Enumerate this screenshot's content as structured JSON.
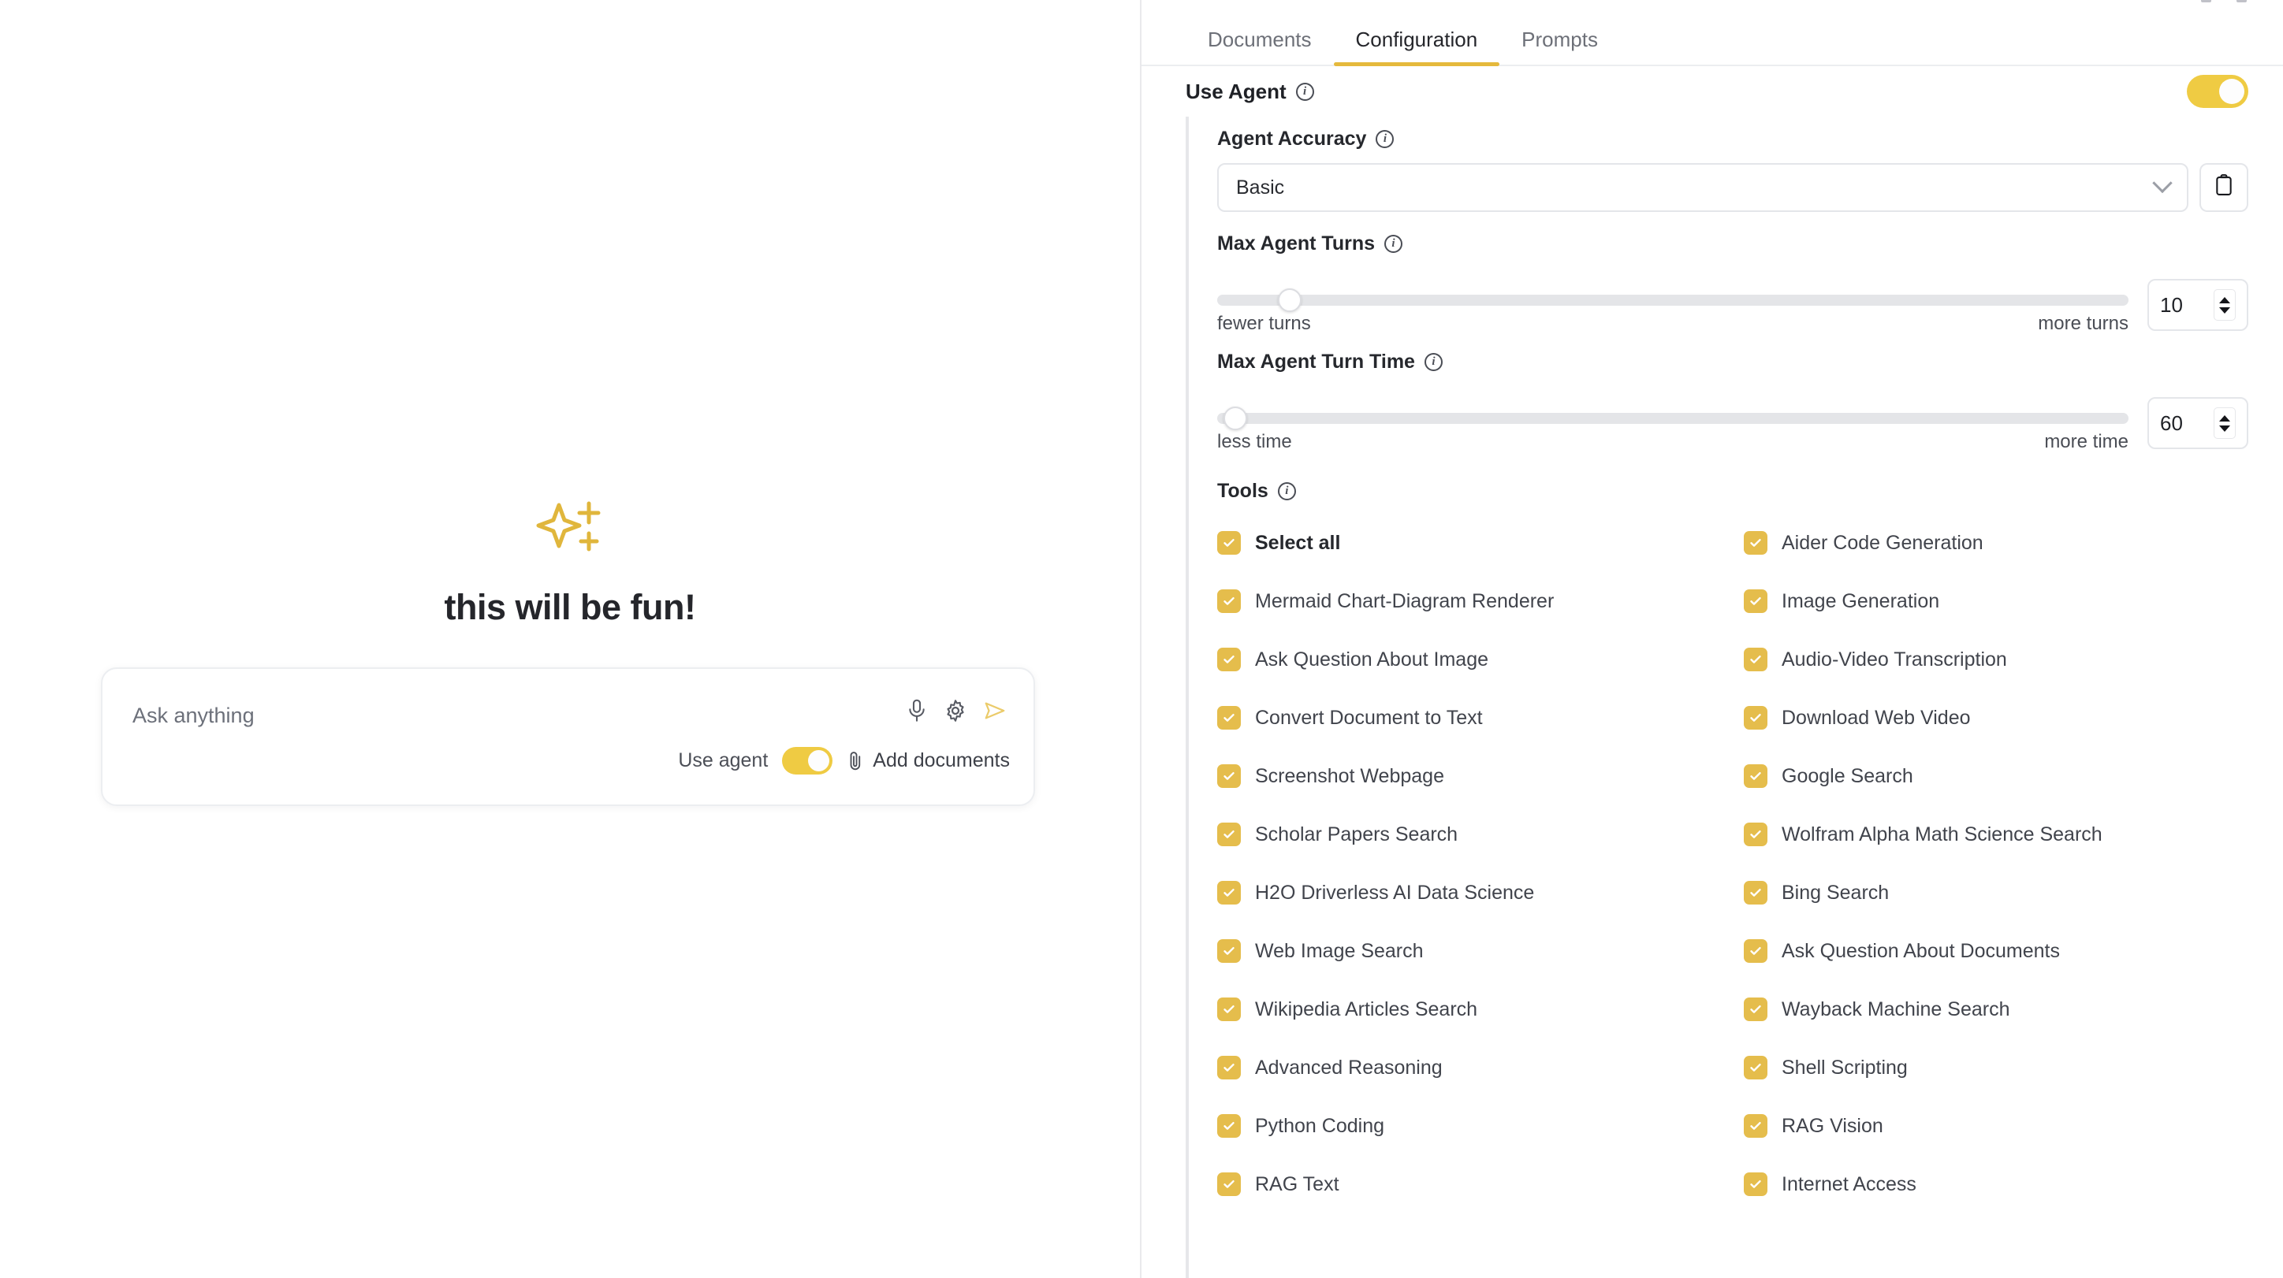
{
  "colors": {
    "accent_yellow": "#EFCB43",
    "checkbox_yellow": "#E5BD4C",
    "tab_underline": "#E5B93C",
    "text_dark": "#25262b",
    "text_muted": "#6d7078"
  },
  "chat": {
    "hero_title": "this will be fun!",
    "sparkle_icon": "sparkle-icon",
    "composer": {
      "placeholder": "Ask anything",
      "mic_icon": "microphone-icon",
      "settings_icon": "gear-icon",
      "send_icon": "send-icon",
      "use_agent_label": "Use agent",
      "use_agent_on": true,
      "attachment_icon": "paperclip-icon",
      "add_documents_label": "Add documents"
    }
  },
  "config": {
    "tabs": [
      {
        "label": "Documents",
        "active": false
      },
      {
        "label": "Configuration",
        "active": true
      },
      {
        "label": "Prompts",
        "active": false
      }
    ],
    "use_agent": {
      "label": "Use Agent",
      "info_icon": "info-icon",
      "enabled": true
    },
    "agent_accuracy": {
      "label": "Agent Accuracy",
      "info_icon": "info-icon",
      "value": "Basic",
      "chevron_icon": "chevron-down-icon",
      "copy_icon": "clipboard-icon"
    },
    "max_agent_turns": {
      "label": "Max Agent Turns",
      "info_icon": "info-icon",
      "value": "10",
      "min_label": "fewer turns",
      "max_label": "more turns",
      "slider_percent": 8
    },
    "max_agent_turn_time": {
      "label": "Max Agent Turn Time",
      "info_icon": "info-icon",
      "value": "60",
      "min_label": "less time",
      "max_label": "more time",
      "slider_percent": 2
    },
    "tools": {
      "label": "Tools",
      "info_icon": "info-icon",
      "left_column": [
        {
          "label": "Select all",
          "checked": true,
          "bold": true
        },
        {
          "label": "Mermaid Chart-Diagram Renderer",
          "checked": true,
          "bold": false
        },
        {
          "label": "Ask Question About Image",
          "checked": true,
          "bold": false
        },
        {
          "label": "Convert Document to Text",
          "checked": true,
          "bold": false
        },
        {
          "label": "Screenshot Webpage",
          "checked": true,
          "bold": false
        },
        {
          "label": "Scholar Papers Search",
          "checked": true,
          "bold": false
        },
        {
          "label": "H2O Driverless AI Data Science",
          "checked": true,
          "bold": false
        },
        {
          "label": "Web Image Search",
          "checked": true,
          "bold": false
        },
        {
          "label": "Wikipedia Articles Search",
          "checked": true,
          "bold": false
        },
        {
          "label": "Advanced Reasoning",
          "checked": true,
          "bold": false
        },
        {
          "label": "Python Coding",
          "checked": true,
          "bold": false
        },
        {
          "label": "RAG Text",
          "checked": true,
          "bold": false
        }
      ],
      "right_column": [
        {
          "label": "Aider Code Generation",
          "checked": true,
          "bold": false
        },
        {
          "label": "Image Generation",
          "checked": true,
          "bold": false
        },
        {
          "label": "Audio-Video Transcription",
          "checked": true,
          "bold": false
        },
        {
          "label": "Download Web Video",
          "checked": true,
          "bold": false
        },
        {
          "label": "Google Search",
          "checked": true,
          "bold": false
        },
        {
          "label": "Wolfram Alpha Math Science Search",
          "checked": true,
          "bold": false
        },
        {
          "label": "Bing Search",
          "checked": true,
          "bold": false
        },
        {
          "label": "Ask Question About Documents",
          "checked": true,
          "bold": false
        },
        {
          "label": "Wayback Machine Search",
          "checked": true,
          "bold": false
        },
        {
          "label": "Shell Scripting",
          "checked": true,
          "bold": false
        },
        {
          "label": "RAG Vision",
          "checked": true,
          "bold": false
        },
        {
          "label": "Internet Access",
          "checked": true,
          "bold": false
        }
      ]
    }
  }
}
